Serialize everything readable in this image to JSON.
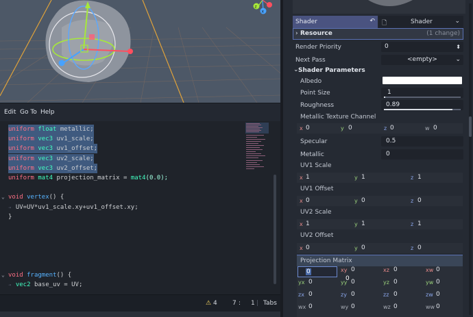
{
  "script_menu": {
    "edit": "Edit",
    "go_to": "Go To",
    "help": "Help"
  },
  "code_lines": [
    {
      "tokens": [
        {
          "t": "uniform",
          "c": "kw"
        },
        {
          "t": " "
        },
        {
          "t": "float",
          "c": "ty"
        },
        {
          "t": " metallic;",
          "c": "id"
        }
      ],
      "selected": true
    },
    {
      "tokens": [
        {
          "t": "uniform",
          "c": "kw"
        },
        {
          "t": " "
        },
        {
          "t": "vec3",
          "c": "ty"
        },
        {
          "t": " uv1_scale;",
          "c": "id"
        }
      ],
      "selected": true
    },
    {
      "tokens": [
        {
          "t": "uniform",
          "c": "kw"
        },
        {
          "t": " "
        },
        {
          "t": "vec3",
          "c": "ty"
        },
        {
          "t": " uv1_offset;",
          "c": "id"
        }
      ],
      "selected": true
    },
    {
      "tokens": [
        {
          "t": "uniform",
          "c": "kw"
        },
        {
          "t": " "
        },
        {
          "t": "vec3",
          "c": "ty"
        },
        {
          "t": " uv2_scale;",
          "c": "id"
        }
      ],
      "selected": true
    },
    {
      "tokens": [
        {
          "t": "uniform",
          "c": "kw"
        },
        {
          "t": " "
        },
        {
          "t": "vec3",
          "c": "ty"
        },
        {
          "t": " uv2_offset;",
          "c": "id"
        }
      ],
      "selected": true
    },
    {
      "tokens": [
        {
          "t": "uniform",
          "c": "kw"
        },
        {
          "t": " "
        },
        {
          "t": "mat4",
          "c": "ty"
        },
        {
          "t": " projection_matrix = ",
          "c": "id"
        },
        {
          "t": "mat4",
          "c": "ty"
        },
        {
          "t": "(0.0);",
          "c": "num"
        }
      ]
    },
    {
      "tokens": []
    },
    {
      "tokens": [
        {
          "t": "void",
          "c": "kw"
        },
        {
          "t": " "
        },
        {
          "t": "vertex",
          "c": "fn"
        },
        {
          "t": "() {",
          "c": "id"
        }
      ],
      "fold": "⌄"
    },
    {
      "tokens": [
        {
          "t": "  UV=UV*uv1_scale.xy+uv1_offset.xy;",
          "c": "id"
        }
      ],
      "tab": "⇥"
    },
    {
      "tokens": [
        {
          "t": "}",
          "c": "id"
        }
      ]
    },
    {
      "tokens": []
    },
    {
      "tokens": []
    },
    {
      "tokens": []
    },
    {
      "tokens": []
    },
    {
      "tokens": []
    },
    {
      "tokens": [
        {
          "t": "void",
          "c": "kw"
        },
        {
          "t": " "
        },
        {
          "t": "fragment",
          "c": "fn"
        },
        {
          "t": "() {",
          "c": "id"
        }
      ],
      "fold": "⌄"
    },
    {
      "tokens": [
        {
          "t": "  "
        },
        {
          "t": "vec2",
          "c": "ty"
        },
        {
          "t": " base_uv = UV;",
          "c": "id"
        }
      ],
      "tab": "⇥"
    }
  ],
  "status": {
    "warnings": "4",
    "line": "7",
    "separator": ":",
    "column": "1",
    "indent": "Tabs"
  },
  "inspector": {
    "shader_label": "Shader",
    "shader_value": "Shader",
    "resource_label": "Resource",
    "resource_changes": "(1 change)",
    "render_priority_label": "Render Priority",
    "render_priority_value": "0",
    "next_pass_label": "Next Pass",
    "next_pass_value": "<empty>",
    "shader_params_label": "Shader Parameters",
    "albedo_label": "Albedo",
    "albedo_color": "#ffffff",
    "point_size_label": "Point Size",
    "point_size_value": "1",
    "point_size_fraction": 0.01,
    "roughness_label": "Roughness",
    "roughness_value": "0.89",
    "roughness_fraction": 0.89,
    "metallic_channel_label": "Metallic Texture Channel",
    "metallic_channel": {
      "x": "0",
      "y": "0",
      "z": "0",
      "w": "0"
    },
    "specular_label": "Specular",
    "specular_value": "0.5",
    "metallic_label": "Metallic",
    "metallic_value": "0",
    "uv1_scale_label": "UV1 Scale",
    "uv1_scale": {
      "x": "1",
      "y": "1",
      "z": "1"
    },
    "uv1_offset_label": "UV1 Offset",
    "uv1_offset": {
      "x": "0",
      "y": "0",
      "z": "0"
    },
    "uv2_scale_label": "UV2 Scale",
    "uv2_scale": {
      "x": "1",
      "y": "1",
      "z": "1"
    },
    "uv2_offset_label": "UV2 Offset",
    "uv2_offset": {
      "x": "0",
      "y": "0",
      "z": "0"
    },
    "projection_matrix_label": "Projection Matrix",
    "projection_matrix": {
      "xx": "0",
      "xy": "0",
      "xz": "0",
      "xw": "0",
      "yx": "0",
      "yy": "0",
      "yz": "0",
      "yw": "0",
      "zx": "0",
      "zy": "0",
      "zz": "0",
      "zw": "0",
      "wx": "0",
      "wy": "0",
      "wz": "0",
      "ww": "0"
    },
    "tooltip_value": "0"
  },
  "axis_labels": {
    "x": "x",
    "y": "y",
    "z": "z",
    "w": "w"
  },
  "colors": {
    "accent": "#5b72b5",
    "selection": "#3f5a7f",
    "keyword": "#ff7085",
    "type": "#42ffc2",
    "function": "#57b3ff",
    "warning": "#ffdd65"
  }
}
